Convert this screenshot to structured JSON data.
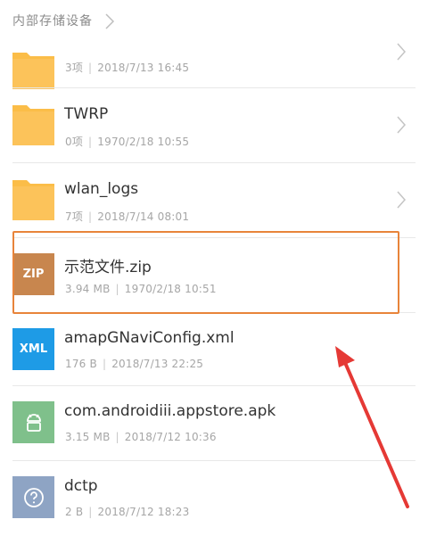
{
  "breadcrumb": {
    "path": "内部存储设备"
  },
  "files": [
    {
      "name": "",
      "count_or_size": "3项",
      "date": "2018/7/13 16:45",
      "type": "folder",
      "icon": "folder-icon"
    },
    {
      "name": "TWRP",
      "count_or_size": "0项",
      "date": "1970/2/18 10:55",
      "type": "folder",
      "icon": "folder-icon"
    },
    {
      "name": "wlan_logs",
      "count_or_size": "7项",
      "date": "2018/7/14 08:01",
      "type": "folder",
      "icon": "folder-icon"
    },
    {
      "name": "示范文件.zip",
      "count_or_size": "3.94 MB",
      "date": "1970/2/18 10:51",
      "type": "zip",
      "icon_label": "ZIP",
      "icon": "zip-file-icon"
    },
    {
      "name": "amapGNaviConfig.xml",
      "count_or_size": "176 B",
      "date": "2018/7/13 22:25",
      "type": "xml",
      "icon_label": "XML",
      "icon": "xml-file-icon"
    },
    {
      "name": "com.androidiii.appstore.apk",
      "count_or_size": "3.15 MB",
      "date": "2018/7/12 10:36",
      "type": "apk",
      "icon": "android-apk-icon"
    },
    {
      "name": "dctp",
      "count_or_size": "2 B",
      "date": "2018/7/12 18:23",
      "type": "unknown",
      "icon": "unknown-file-icon"
    }
  ],
  "colors": {
    "folder": "#fbbd48",
    "zip": "#c8864e",
    "xml": "#1e9be6",
    "apk": "#7fc08b",
    "unknown": "#8ea4c4",
    "highlight": "#e8843a",
    "annotation_arrow": "#e53935"
  }
}
